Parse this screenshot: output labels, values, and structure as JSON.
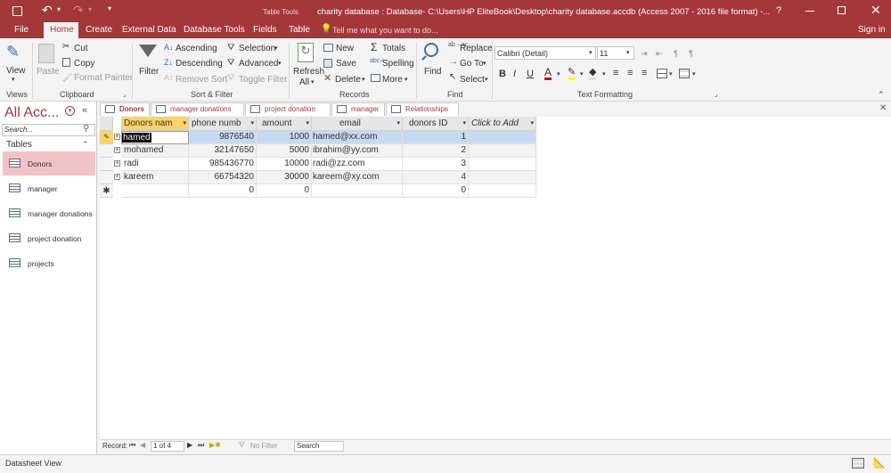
{
  "titlebar": {
    "contextual": "Table Tools",
    "title": "charity database : Database- C:\\Users\\HP EliteBook\\Desktop\\charity database.accdb (Access 2007 - 2016 file format) -...",
    "help": "?",
    "signin": "Sign in"
  },
  "tabs": [
    "File",
    "Home",
    "Create",
    "External Data",
    "Database Tools",
    "Fields",
    "Table"
  ],
  "tellme": "Tell me what you want to do...",
  "ribbon": {
    "view": "View",
    "paste": "Paste",
    "cut": "Cut",
    "copy": "Copy",
    "format_painter": "Format Painter",
    "filter": "Filter",
    "ascending": "Ascending",
    "descending": "Descending",
    "remove_sort": "Remove Sort",
    "selection": "Selection",
    "advanced": "Advanced",
    "toggle_filter": "Toggle Filter",
    "refresh": "Refresh",
    "refresh2": "All",
    "new": "New",
    "save": "Save",
    "delete": "Delete",
    "totals": "Totals",
    "spelling": "Spelling",
    "more": "More",
    "find": "Find",
    "replace": "Replace",
    "goto": "Go To",
    "select": "Select",
    "font": "Calibri (Detail)",
    "size": "11",
    "bold": "B",
    "italic": "I",
    "underline": "U",
    "groups": {
      "views": "Views",
      "clipboard": "Clipboard",
      "sortfilter": "Sort & Filter",
      "records": "Records",
      "find": "Find",
      "textfmt": "Text Formatting"
    }
  },
  "nav": {
    "title": "All Acc...",
    "search": "Search...",
    "section": "Tables",
    "items": [
      "Donors",
      "manager",
      "manager donations",
      "project donation",
      "projects"
    ]
  },
  "doctabs": [
    "Donors",
    "manager donations",
    "project donation",
    "manager",
    "Relationships"
  ],
  "columns": [
    "Donors nam",
    "phone numb",
    "amount",
    "email",
    "donors ID",
    "Click to Add"
  ],
  "rows": [
    {
      "name": "hamed",
      "phone": "9876540",
      "amount": "1000",
      "email": "hamed@xx.com",
      "id": "1"
    },
    {
      "name": "mohamed",
      "phone": "32147650",
      "amount": "5000",
      "email": "ibrahim@yy.com",
      "id": "2"
    },
    {
      "name": "radi",
      "phone": "985436770",
      "amount": "10000",
      "email": "radi@zz.com",
      "id": "3"
    },
    {
      "name": "kareem",
      "phone": "66754320",
      "amount": "30000",
      "email": "kareem@xy.com",
      "id": "4"
    }
  ],
  "newrow": {
    "phone": "0",
    "amount": "0",
    "id": "0"
  },
  "recordbar": {
    "label": "Record:",
    "position": "1 of 4",
    "nofilter": "No Filter",
    "search": "Search"
  },
  "status": "Datasheet View"
}
